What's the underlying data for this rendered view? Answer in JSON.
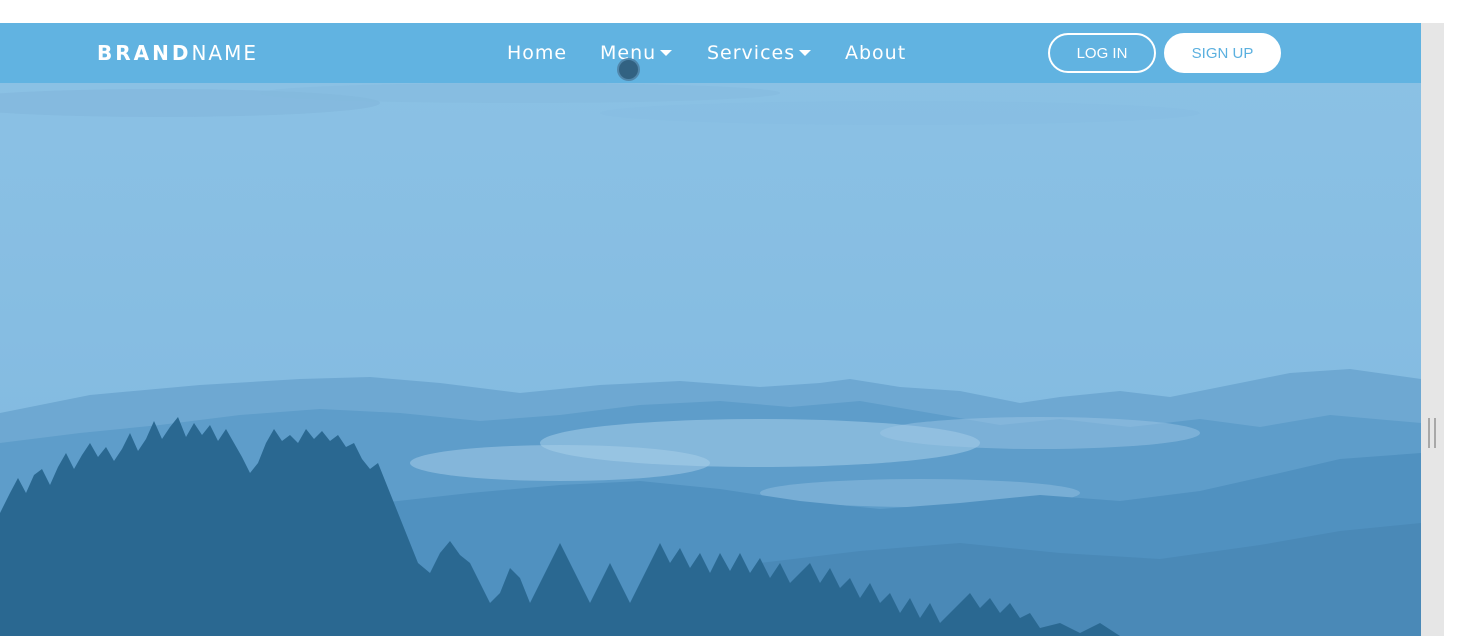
{
  "navbar": {
    "brand_bold": "BRAND",
    "brand_light": "NAME",
    "items": [
      {
        "label": "Home",
        "has_dropdown": false
      },
      {
        "label": "Menu",
        "has_dropdown": true
      },
      {
        "label": "Services",
        "has_dropdown": true
      },
      {
        "label": "About",
        "has_dropdown": false
      }
    ],
    "login_label": "LOG IN",
    "signup_label": "SIGN UP"
  },
  "hero": {
    "image": "misty-mountain-forest-landscape"
  },
  "colors": {
    "navbar_bg": "#61b3e1",
    "sky": "#89c0e4",
    "trees": "#2a6891",
    "accent_text": "#5bb0df"
  },
  "icons": {
    "dropdown": "caret-down-icon",
    "scroll_grip": "scroll-grip-icon"
  }
}
